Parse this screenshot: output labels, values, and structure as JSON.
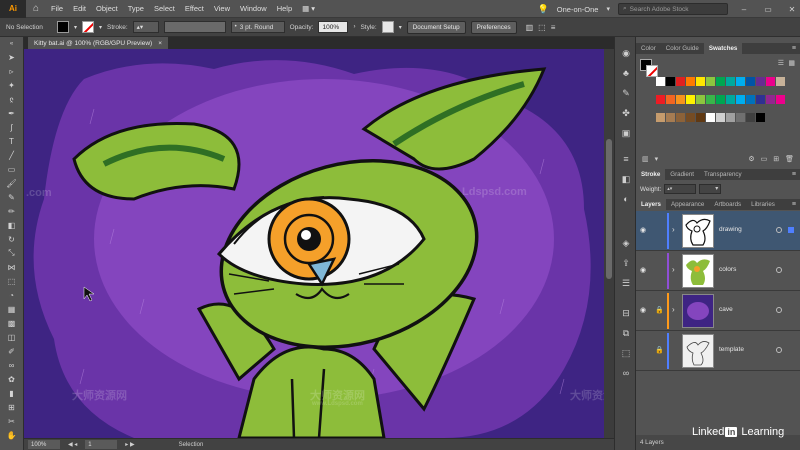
{
  "menubar": {
    "logo": "Ai",
    "items": [
      "File",
      "Edit",
      "Object",
      "Type",
      "Select",
      "Effect",
      "View",
      "Window",
      "Help"
    ],
    "workspace": "One-on-One",
    "search_placeholder": "Search Adobe Stock"
  },
  "controlbar": {
    "selection": "No Selection",
    "stroke_label": "Stroke:",
    "brush": "3 pt. Round",
    "opacity_label": "Opacity:",
    "opacity_value": "100%",
    "style_label": "Style:",
    "document_setup": "Document Setup",
    "preferences": "Preferences"
  },
  "document_tab": {
    "title": "Kitty bat.ai @ 100% (RGB/GPU Preview)",
    "close": "×"
  },
  "statusbar": {
    "zoom": "100%",
    "artboard": "1",
    "status": "Selection"
  },
  "color_panel": {
    "tabs": [
      "Color",
      "Color Guide",
      "Swatches"
    ],
    "active_tab": "Swatches"
  },
  "swatches": [
    [
      "#ffffff",
      "#000000",
      "#e02020",
      "#ff7a00",
      "#ffe600",
      "#8cc63f",
      "#00a651",
      "#00a99d",
      "#00aeef",
      "#0054a6",
      "#662d91",
      "#ec008c",
      "#c7b299"
    ],
    [
      "#ed1c24",
      "#f26522",
      "#f7941d",
      "#fff200",
      "#8dc63f",
      "#39b54a",
      "#00a651",
      "#00a99d",
      "#00aeef",
      "#0072bc",
      "#2e3192",
      "#92278f",
      "#ec008c"
    ],
    [
      "#c69c6d",
      "#a67c52",
      "#8c6239",
      "#754c24",
      "#603913",
      "#ffffff",
      "#d0d0d0",
      "#a0a0a0",
      "#707070",
      "#404040",
      "#000000"
    ]
  ],
  "stroke_panel": {
    "tabs": [
      "Stroke",
      "Gradient",
      "Transparency"
    ],
    "active_tab": "Stroke",
    "weight_label": "Weight:"
  },
  "layers_panel": {
    "tabs": [
      "Layers",
      "Appearance",
      "Artboards",
      "Libraries"
    ],
    "active_tab": "Layers",
    "layers": [
      {
        "name": "drawing",
        "color": "#4f7fff",
        "selected": true,
        "locked": false
      },
      {
        "name": "colors",
        "color": "#8f4fd6",
        "selected": false,
        "locked": false
      },
      {
        "name": "cave",
        "color": "#ff9a1a",
        "selected": false,
        "locked": true
      },
      {
        "name": "template",
        "color": "#4f7fff",
        "selected": false,
        "locked": true
      }
    ],
    "count": "4 Layers"
  },
  "brand": {
    "text": "Linked",
    "in": "in",
    "suffix": "Learning"
  },
  "watermarks": [
    "Ldspsd.com",
    ".com",
    "大师资源网",
    "www.Ldspsd.com"
  ]
}
